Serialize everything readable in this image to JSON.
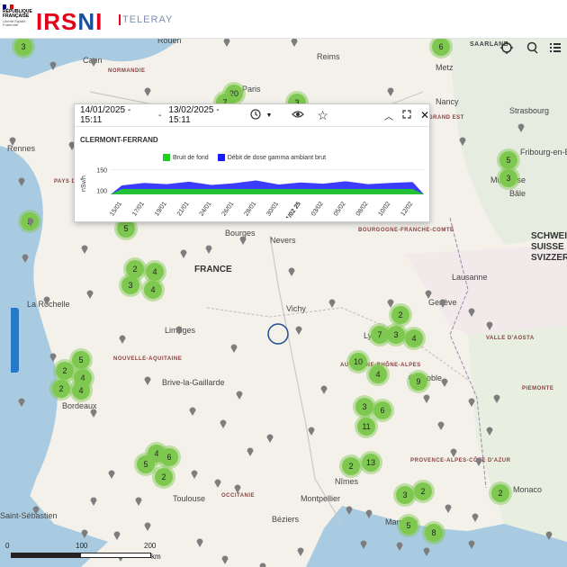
{
  "header": {
    "republic_line1": "RÉPUBLIQUE",
    "republic_line2": "FRANÇAISE",
    "motto": "Liberté Égalité Fraternité",
    "logo_text_left": "IRS",
    "logo_text_mid": "N",
    "logo_text_right": "I",
    "app_name": "TELERAY",
    "brand_color": "#e2001a"
  },
  "popup": {
    "date_start": "14/01/2025 - 15:11",
    "date_end": "13/02/2025 - 15:11",
    "separator": "-",
    "station": "CLERMONT-FERRAND",
    "legend": [
      {
        "label": "Bruit de fond",
        "color": "#22d022"
      },
      {
        "label": "Débit de dose gamma ambiant brut",
        "color": "#1a1aff"
      }
    ]
  },
  "chart_data": {
    "type": "area",
    "ylabel": "nSv/h",
    "yticks": [
      "150",
      "100"
    ],
    "ylim": [
      90,
      160
    ],
    "categories": [
      "15/01",
      "17/01",
      "19/01",
      "21/01",
      "24/01",
      "26/01",
      "28/01",
      "30/01",
      "01/02 25",
      "03/02",
      "05/02",
      "08/02",
      "10/02",
      "12/02"
    ],
    "series": [
      {
        "name": "Bruit de fond",
        "values": [
          103,
          103,
          103,
          103,
          103,
          103,
          103,
          103,
          103,
          103,
          103,
          103,
          103,
          103
        ]
      },
      {
        "name": "Débit de dose gamma ambiant brut",
        "values": [
          112,
          118,
          115,
          121,
          113,
          117,
          124,
          114,
          119,
          116,
          122,
          115,
          118,
          120
        ]
      }
    ]
  },
  "map": {
    "cities": [
      "Rouen",
      "Reims",
      "Paris",
      "Metz",
      "Nancy",
      "Strasbourg",
      "Rennes",
      "Bourges",
      "Nevers",
      "Vichy",
      "Limoges",
      "La Rochelle",
      "Bordeaux",
      "Brive-la-Gaillarde",
      "Lyon",
      "Grenoble",
      "Nîmes",
      "Montpellier",
      "Toulouse",
      "Marseille",
      "Béziers",
      "Genève",
      "Lausanne",
      "Mulhouse",
      "Fribourg-en-Brisgau",
      "Bâle",
      "Caen",
      "Monaco",
      "Saint-Sébastien"
    ],
    "regions": [
      "NORMANDIE",
      "PAYS DE LA LOIRE",
      "BOURGOGNE-FRANCHE-COMTÉ",
      "NOUVELLE-AQUITAINE",
      "AUVERGNE-RHÔNE-ALPES",
      "OCCITANIE",
      "PROVENCE-ALPES-CÔTE D'AZUR",
      "GRAND EST",
      "VALLE D'AOSTA",
      "PIEMONTE"
    ],
    "country": "FRANCE",
    "switzerland": "SCHWEIZ SUISSE SVIZZERA",
    "saarland": "SAARLAND",
    "clusters": [
      "3",
      "6",
      "20",
      "7",
      "3",
      "5",
      "3",
      "2",
      "5",
      "2",
      "4",
      "3",
      "4",
      "7",
      "3",
      "4",
      "2",
      "10",
      "4",
      "9",
      "3",
      "6",
      "11",
      "2",
      "13",
      "3",
      "2",
      "5",
      "2",
      "4",
      "2",
      "4",
      "4",
      "6",
      "5",
      "2",
      "5",
      "8",
      "2"
    ],
    "scale_labels": [
      "0",
      "100",
      "200",
      "km"
    ]
  }
}
